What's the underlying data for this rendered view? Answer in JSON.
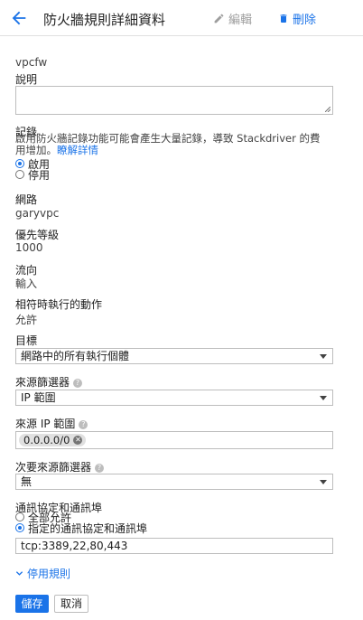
{
  "header": {
    "title": "防火牆規則詳細資料",
    "edit_label": "編輯",
    "delete_label": "刪除"
  },
  "rule_name": "vpcfw",
  "description": {
    "label": "說明",
    "value": ""
  },
  "logging": {
    "label": "記錄",
    "note_line1": "啟用防火牆記錄功能可能會產生大量記錄，導致 Stackdriver 的費",
    "note_line2": "用增加。",
    "more_link": "瞭解詳情",
    "options": [
      "啟用",
      "停用"
    ],
    "selected": "啟用"
  },
  "network": {
    "label": "網路",
    "value": "garyvpc"
  },
  "priority": {
    "label": "優先等級",
    "value": "1000"
  },
  "direction": {
    "label": "流向",
    "value": "輸入"
  },
  "action": {
    "label": "相符時執行的動作",
    "value": "允許"
  },
  "target": {
    "label": "目標",
    "value": "網路中的所有執行個體"
  },
  "source_filter": {
    "label": "來源篩選器",
    "value": "IP 範圍"
  },
  "source_ip_ranges": {
    "label": "來源 IP 範圍",
    "chips": [
      "0.0.0.0/0"
    ]
  },
  "secondary_source_filter": {
    "label": "次要來源篩選器",
    "value": "無"
  },
  "protocols_ports": {
    "label": "通訊協定和通訊埠",
    "options": [
      "全部允許",
      "指定的通訊協定和通訊埠"
    ],
    "selected": "指定的通訊協定和通訊埠",
    "value": "tcp:3389,22,80,443"
  },
  "disable_rule_link": "停用規則",
  "buttons": {
    "save": "儲存",
    "cancel": "取消"
  },
  "colors": {
    "accent": "#1a73e8",
    "border": "#bdbdbd",
    "muted": "#9e9e9e"
  }
}
